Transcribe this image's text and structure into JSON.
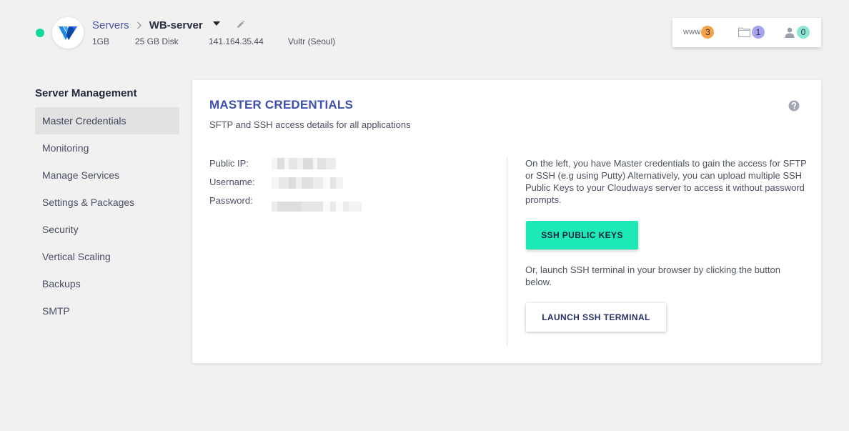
{
  "header": {
    "breadcrumb_servers": "Servers",
    "breadcrumb_sep": ">",
    "server_name": "WB-server",
    "status_color": "#16d79a",
    "meta": {
      "ram": "1GB",
      "disk": "25 GB Disk",
      "ip": "141.164.35.44",
      "provider": "Vultr (Seoul)"
    },
    "counters": {
      "www_label": "www",
      "www_count": "3",
      "www_color": "#f6a34b",
      "files_count": "1",
      "files_color": "#a7a4ef",
      "users_count": "0",
      "users_color": "#8ee7d2"
    }
  },
  "sidebar": {
    "title": "Server Management",
    "items": [
      {
        "label": "Master Credentials"
      },
      {
        "label": "Monitoring"
      },
      {
        "label": "Manage Services"
      },
      {
        "label": "Settings & Packages"
      },
      {
        "label": "Security"
      },
      {
        "label": "Vertical Scaling"
      },
      {
        "label": "Backups"
      },
      {
        "label": "SMTP"
      }
    ]
  },
  "main": {
    "title": "MASTER CREDENTIALS",
    "subtitle": "SFTP and SSH access details for all applications",
    "labels": {
      "public_ip": "Public IP:",
      "username": "Username:",
      "password": "Password:"
    },
    "info_text": "On the left, you have Master credentials to gain the access for SFTP or SSH (e.g using Putty) Alternatively, you can upload multiple SSH Public Keys to your Cloudways server to access it without password prompts.",
    "ssh_keys_button": "SSH PUBLIC KEYS",
    "info_text_2": "Or, launch SSH terminal in your browser by clicking the button below.",
    "launch_terminal_button": "LAUNCH SSH TERMINAL",
    "accent_color": "#1de9b6",
    "title_color": "#3d4fb0"
  }
}
